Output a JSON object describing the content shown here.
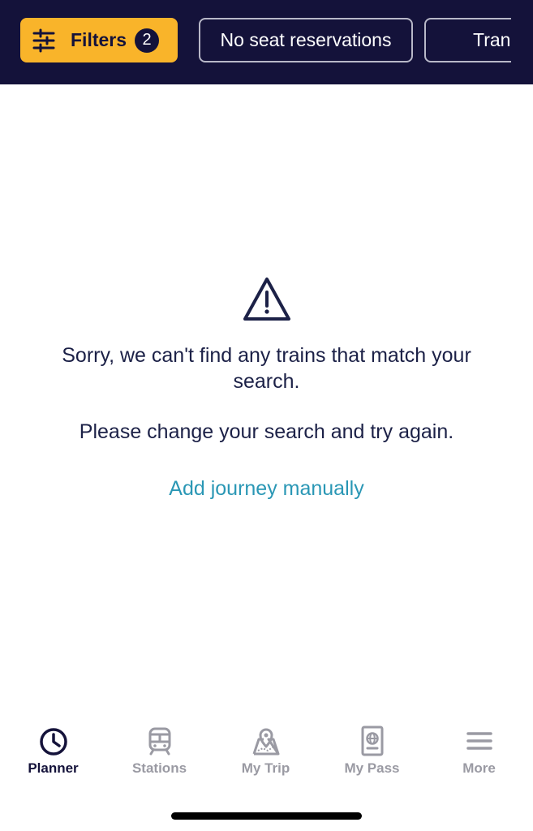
{
  "filters": {
    "filters_label": "Filters",
    "filters_count": "2",
    "chips": [
      "No seat reservations",
      "Tran"
    ]
  },
  "empty_state": {
    "icon": "warning-triangle-icon",
    "message_line1": "Sorry, we can't find any trains that match your search.",
    "message_line2": "Please change your search and try again.",
    "link_label": "Add journey manually"
  },
  "tabs": [
    {
      "label": "Planner",
      "icon": "clock-icon",
      "active": true
    },
    {
      "label": "Stations",
      "icon": "train-icon",
      "active": false
    },
    {
      "label": "My Trip",
      "icon": "map-pin-icon",
      "active": false
    },
    {
      "label": "My Pass",
      "icon": "passport-icon",
      "active": false
    },
    {
      "label": "More",
      "icon": "menu-icon",
      "active": false
    }
  ],
  "colors": {
    "header_bg": "#14123a",
    "filter_accent": "#f9b42a",
    "link": "#2a97b5",
    "text": "#1c2147",
    "tab_inactive": "#9a9aa3"
  }
}
